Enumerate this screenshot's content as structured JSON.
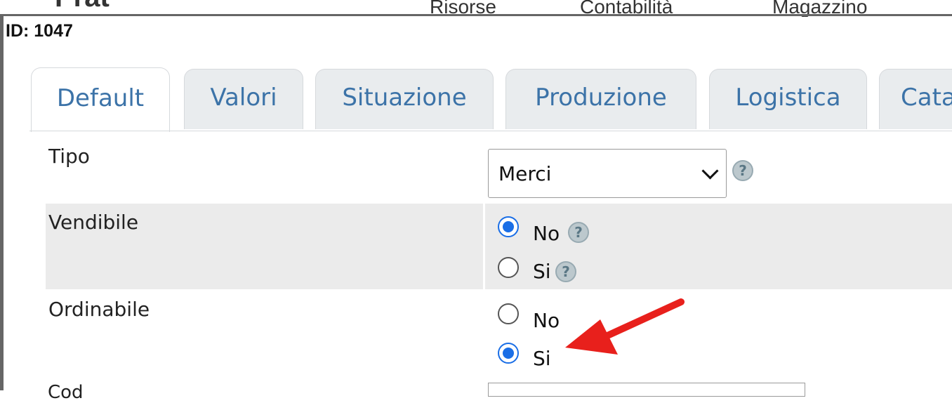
{
  "header": {
    "brand": "Prat",
    "nav": [
      "Risorse",
      "Contabilità",
      "Magazzino"
    ]
  },
  "record": {
    "id_label": "ID: 1047"
  },
  "tabs": [
    {
      "label": "Default",
      "active": true
    },
    {
      "label": "Valori",
      "active": false
    },
    {
      "label": "Situazione",
      "active": false
    },
    {
      "label": "Produzione",
      "active": false
    },
    {
      "label": "Logistica",
      "active": false
    },
    {
      "label": "Cata",
      "active": false
    }
  ],
  "form": {
    "tipo": {
      "label": "Tipo",
      "value": "Merci",
      "help": "?"
    },
    "vendibile": {
      "label": "Vendibile",
      "options": [
        {
          "label": "No",
          "checked": true,
          "help": "?"
        },
        {
          "label": "Si",
          "checked": false,
          "help": "?"
        }
      ]
    },
    "ordinabile": {
      "label": "Ordinabile",
      "options": [
        {
          "label": "No",
          "checked": false
        },
        {
          "label": "Si",
          "checked": true
        }
      ]
    },
    "next_row_label": "Cod"
  },
  "colors": {
    "tab_text": "#3c73a8",
    "radio_checked": "#1a6ee6",
    "row_shade": "#ebebeb",
    "annotation_arrow": "#e8201c"
  }
}
